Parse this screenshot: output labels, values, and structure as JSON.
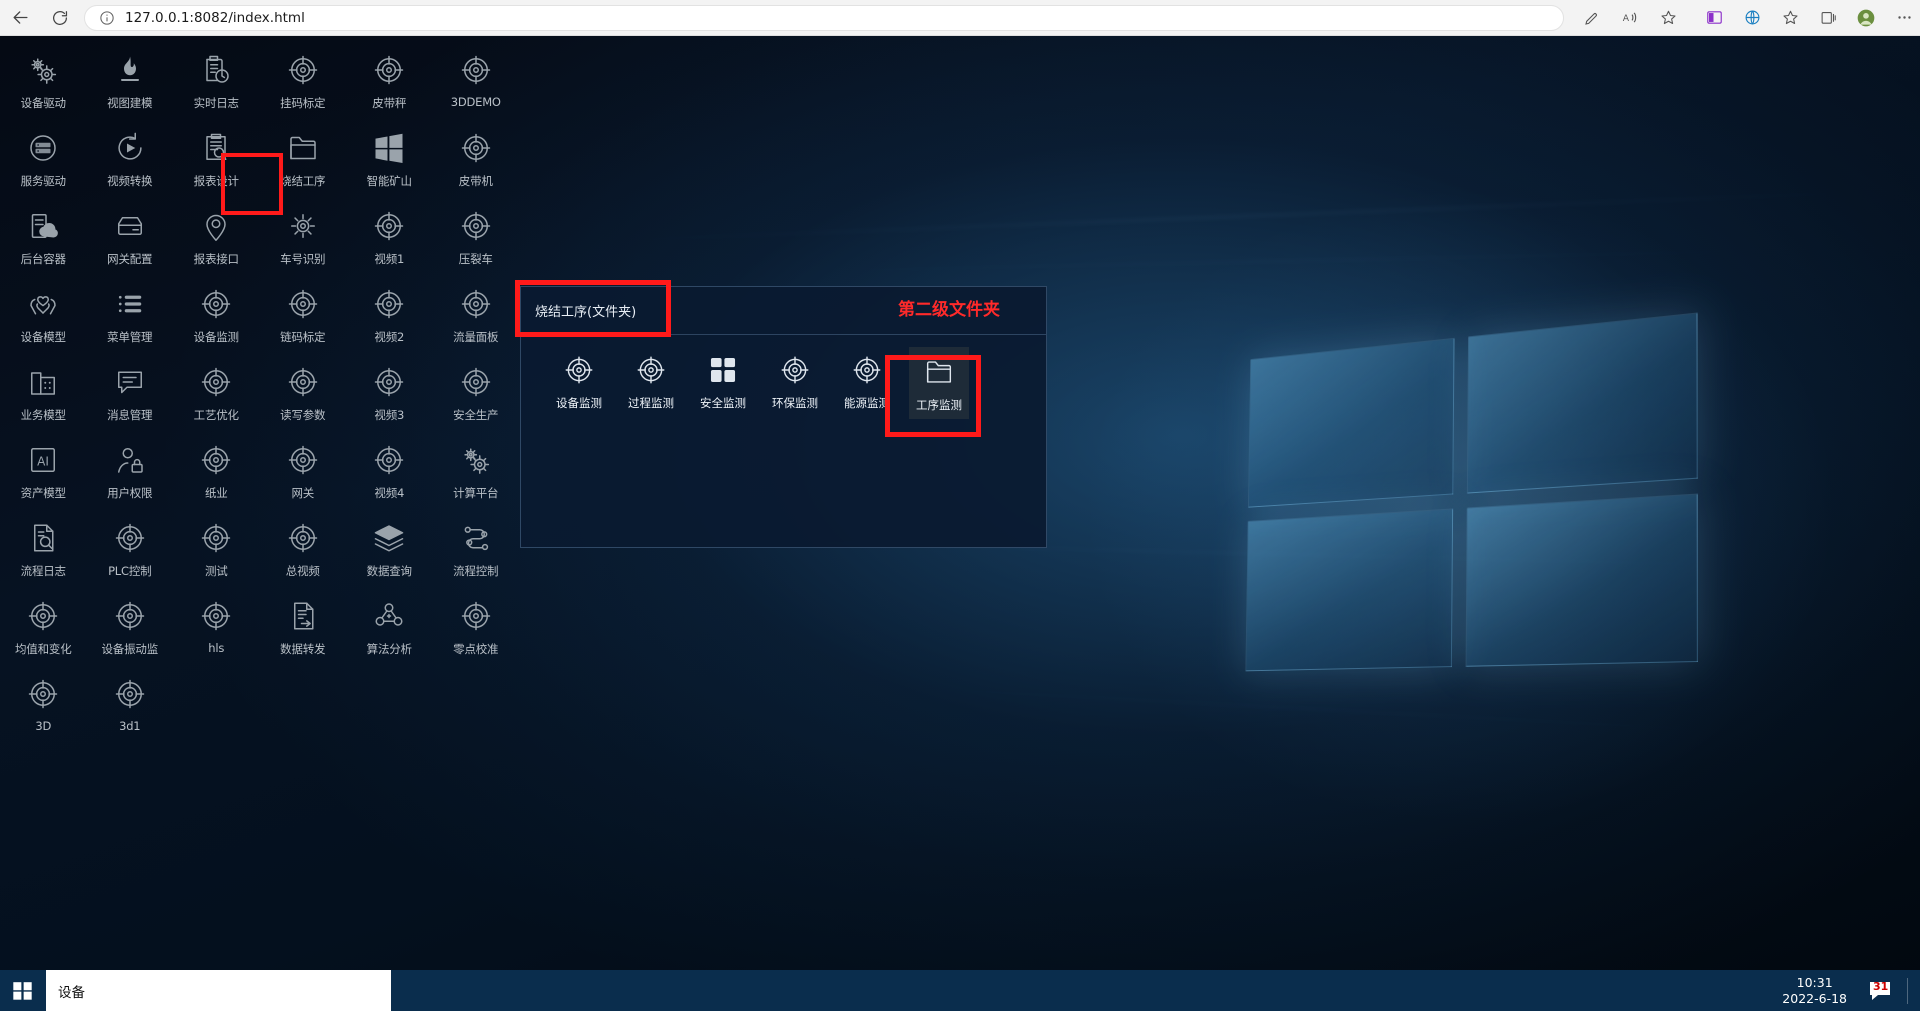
{
  "browser": {
    "back_icon": "back-arrow-icon",
    "reload_icon": "reload-icon",
    "info_icon": "info-circle-icon",
    "url": "127.0.0.1:8082/index.html",
    "toolbar_icons": [
      "pen-icon",
      "read-aloud-icon",
      "favorite-star-icon",
      "split-screen-icon",
      "browser-essentials-icon",
      "favorites-icon",
      "collections-icon",
      "profile-avatar-icon",
      "settings-more-icon"
    ]
  },
  "desktop": {
    "apps": [
      {
        "label": "设备驱动",
        "icon": "gears-icon"
      },
      {
        "label": "视图建模",
        "icon": "flame-icon"
      },
      {
        "label": "实时日志",
        "icon": "clipboard-clock-icon"
      },
      {
        "label": "挂码标定",
        "icon": "target-icon"
      },
      {
        "label": "皮带秤",
        "icon": "target-icon"
      },
      {
        "label": "3DDEMO",
        "icon": "target-icon"
      },
      {
        "label": "服务驱动",
        "icon": "server-icon"
      },
      {
        "label": "视频转换",
        "icon": "video-convert-icon"
      },
      {
        "label": "报表设计",
        "icon": "clipboard-search-icon"
      },
      {
        "label": "烧结工序",
        "icon": "folder-icon"
      },
      {
        "label": "智能矿山",
        "icon": "windows-icon"
      },
      {
        "label": "皮带机",
        "icon": "target-icon"
      },
      {
        "label": "后台容器",
        "icon": "server-cloud-icon"
      },
      {
        "label": "网关配置",
        "icon": "gateway-icon"
      },
      {
        "label": "报表接口",
        "icon": "location-pin-icon"
      },
      {
        "label": "车号识别",
        "icon": "gear-icon"
      },
      {
        "label": "视频1",
        "icon": "target-icon"
      },
      {
        "label": "压裂车",
        "icon": "target-icon"
      },
      {
        "label": "设备模型",
        "icon": "hands-heart-icon"
      },
      {
        "label": "菜单管理",
        "icon": "list-icon"
      },
      {
        "label": "设备监测",
        "icon": "target-icon"
      },
      {
        "label": "链码标定",
        "icon": "target-icon"
      },
      {
        "label": "视频2",
        "icon": "target-icon"
      },
      {
        "label": "流量面板",
        "icon": "target-icon"
      },
      {
        "label": "业务模型",
        "icon": "building-icon"
      },
      {
        "label": "消息管理",
        "icon": "chat-icon"
      },
      {
        "label": "工艺优化",
        "icon": "target-icon"
      },
      {
        "label": "读写参数",
        "icon": "target-icon"
      },
      {
        "label": "视频3",
        "icon": "target-icon"
      },
      {
        "label": "安全生产",
        "icon": "target-icon"
      },
      {
        "label": "资产模型",
        "icon": "ai-icon"
      },
      {
        "label": "用户权限",
        "icon": "user-lock-icon"
      },
      {
        "label": "纸业",
        "icon": "target-icon"
      },
      {
        "label": "网关",
        "icon": "target-icon"
      },
      {
        "label": "视频4",
        "icon": "target-icon"
      },
      {
        "label": "计算平台",
        "icon": "gears-icon"
      },
      {
        "label": "流程日志",
        "icon": "document-search-icon"
      },
      {
        "label": "PLC控制",
        "icon": "target-icon"
      },
      {
        "label": "测试",
        "icon": "target-icon"
      },
      {
        "label": "总视频",
        "icon": "target-icon"
      },
      {
        "label": "数据查询",
        "icon": "layers-icon"
      },
      {
        "label": "流程控制",
        "icon": "flow-icon"
      },
      {
        "label": "均值和变化",
        "icon": "target-icon"
      },
      {
        "label": "设备振动监",
        "icon": "target-icon"
      },
      {
        "label": "hls",
        "icon": "target-icon"
      },
      {
        "label": "数据转发",
        "icon": "document-forward-icon"
      },
      {
        "label": "算法分析",
        "icon": "algorithm-icon"
      },
      {
        "label": "零点校准",
        "icon": "target-icon"
      },
      {
        "label": "3D",
        "icon": "target-icon"
      },
      {
        "label": "3d1",
        "icon": "target-icon"
      }
    ]
  },
  "folder_popup": {
    "title": "烧结工序(文件夹)",
    "annotation": "第二级文件夹",
    "items": [
      {
        "label": "设备监测",
        "icon": "target-icon"
      },
      {
        "label": "过程监测",
        "icon": "target-icon"
      },
      {
        "label": "安全监测",
        "icon": "grid-tiles-icon"
      },
      {
        "label": "环保监测",
        "icon": "target-icon"
      },
      {
        "label": "能源监测",
        "icon": "target-icon"
      },
      {
        "label": "工序监测",
        "icon": "folder-icon"
      }
    ],
    "selected_index": 5
  },
  "taskbar": {
    "start_icon": "windows-start-icon",
    "app_label": "设备",
    "time": "10:31",
    "date": "2022-6-18",
    "notification_icon": "speech-bubble-icon",
    "notification_count": "31"
  },
  "colors": {
    "annotation_red": "#ff1a1a",
    "taskbar_blue": "#0a2d4d",
    "desktop_dark": "#04101e",
    "icon_gray": "#9aa3ab"
  }
}
